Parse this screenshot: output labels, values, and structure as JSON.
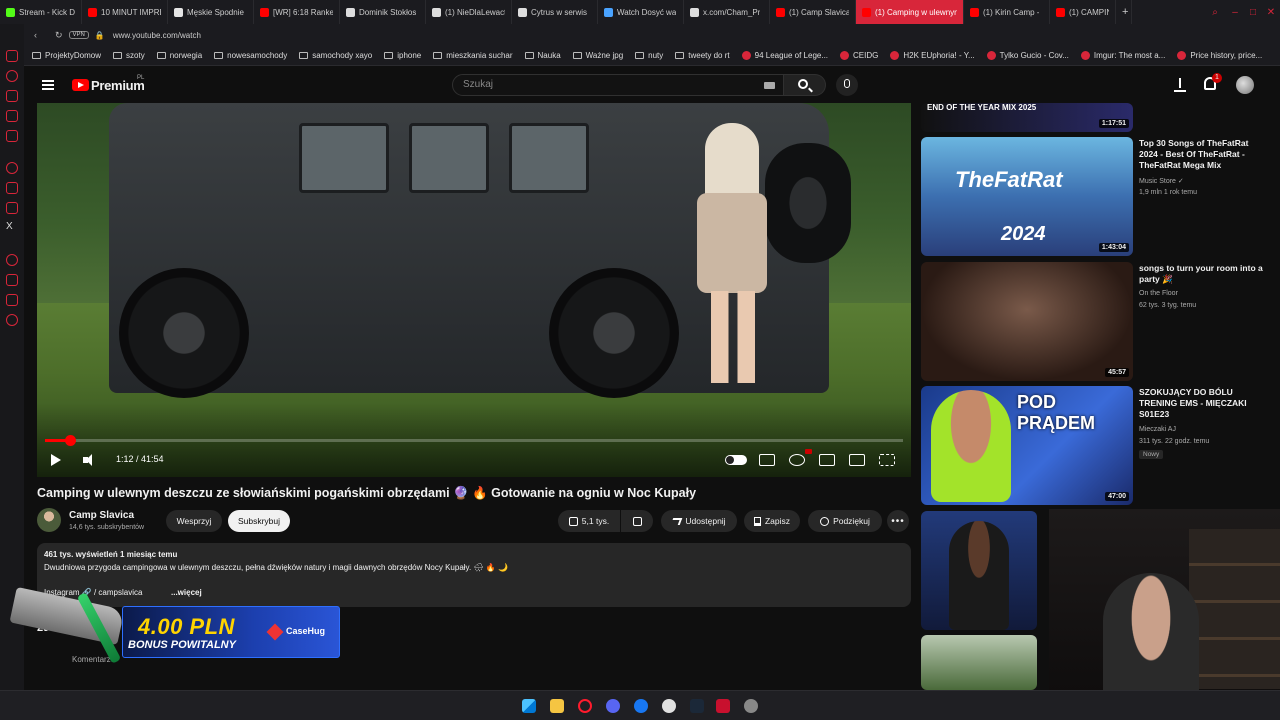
{
  "browser": {
    "tabs": [
      {
        "title": "Stream - Kick Da",
        "favicon_color": "#53fc18"
      },
      {
        "title": "10 MINUT IMPRE",
        "favicon_color": "#ff0000"
      },
      {
        "title": "Męskie Spodnie",
        "favicon_color": "#e5e5e5"
      },
      {
        "title": "[WR] 6:18 Ranke",
        "favicon_color": "#ff0000"
      },
      {
        "title": "Dominik Stokłos",
        "favicon_color": "#dddddd"
      },
      {
        "title": "(1) NieDlaLewact",
        "favicon_color": "#dddddd"
      },
      {
        "title": "Cytrus w serwis",
        "favicon_color": "#dddddd"
      },
      {
        "title": "Watch Dosyć wa",
        "favicon_color": "#4aa3ff"
      },
      {
        "title": "x.com/Cham_Pr",
        "favicon_color": "#dddddd"
      },
      {
        "title": "(1) Camp Slavica",
        "favicon_color": "#ff0000"
      },
      {
        "title": "(1) Camping w ulewnym de",
        "favicon_color": "#ff0000",
        "active": true
      },
      {
        "title": "(1) Kirin Camp -",
        "favicon_color": "#ff0000"
      },
      {
        "title": "(1) CAMPING",
        "favicon_color": "#ff0000"
      }
    ],
    "address": {
      "vpn_label": "VPN",
      "url": "www.youtube.com/watch"
    },
    "bookmarks": [
      {
        "label": "ProjektyDomow",
        "icon": "folder-icon"
      },
      {
        "label": "szoty",
        "icon": "folder-icon"
      },
      {
        "label": "norwegia",
        "icon": "folder-icon"
      },
      {
        "label": "nowesamochody",
        "icon": "folder-icon"
      },
      {
        "label": "samochody xayo",
        "icon": "folder-icon"
      },
      {
        "label": "iphone",
        "icon": "folder-icon"
      },
      {
        "label": "mieszkania suchar",
        "icon": "folder-icon"
      },
      {
        "label": "Nauka",
        "icon": "folder-icon"
      },
      {
        "label": "Ważne jpg",
        "icon": "folder-icon"
      },
      {
        "label": "nuty",
        "icon": "folder-icon"
      },
      {
        "label": "tweety do rt",
        "icon": "folder-icon"
      },
      {
        "label": "94 League of Lege...",
        "icon": "site-icon"
      },
      {
        "label": "CEIDG",
        "icon": "site-icon"
      },
      {
        "label": "H2K EUphoria! - Y...",
        "icon": "site-icon"
      },
      {
        "label": "Tylko Gucio - Cov...",
        "icon": "site-icon"
      },
      {
        "label": "Imgur: The most a...",
        "icon": "site-icon"
      },
      {
        "label": "Price history, price...",
        "icon": "site-icon"
      }
    ]
  },
  "youtube": {
    "header": {
      "logo_text": "Premium",
      "country": "PL",
      "search_placeholder": "Szukaj",
      "notification_count": "1"
    },
    "player": {
      "time": "1:12 / 41:54",
      "progress_fraction": 0.029
    },
    "video": {
      "title": "Camping w ulewnym deszczu ze słowiańskimi pogańskimi obrzędami 🔮 🔥 Gotowanie na ogniu w Noc Kupały",
      "channel_name": "Camp Slavica",
      "subscribers": "14,6 tys. subskrybentów",
      "support_label": "Wesprzyj",
      "subscribe_label": "Subskrybuj",
      "likes": "5,1 tys.",
      "share_label": "Udostępnij",
      "save_label": "Zapisz",
      "thanks_label": "Podziękuj"
    },
    "description": {
      "stats": "461 tys. wyświetleń  1 miesiąc temu",
      "line": "Dwudniowa przygoda campingowa w ulewnym deszczu, pełna dźwięków natury i magii dawnych obrzędów Nocy Kupały. 🌧 🔥 🌙",
      "instagram": "Instagram  🔗 / campslavica",
      "more": "...więcej"
    },
    "comments": {
      "count": "290",
      "label": "Komentarze"
    },
    "recommendations": [
      {
        "overlay": "END OF THE YEAR MIX 2025",
        "duration": "1:17:51"
      },
      {
        "title": "Top 30 Songs of TheFatRat 2024 - Best Of TheFatRat - TheFatRat Mega Mix",
        "channel": "Music Store ✓",
        "meta": "1,9 mln  1 rok temu",
        "duration": "1:43:04",
        "overlay1": "TheFatRat",
        "overlay2": "2024"
      },
      {
        "title": "songs to turn your room into a party 🎉",
        "channel": "On the Floor",
        "meta": "62 tys.  3 tyg. temu",
        "duration": "45:57"
      },
      {
        "title": "SZOKUJĄCY DO BÓLU TRENING EMS - MIĘCZAKI S01E23",
        "channel": "Mieczaki AJ",
        "meta": "311 tys.  22 godz. temu",
        "badge": "Nowy",
        "duration": "47:00",
        "overlay": "POD PRĄDEM"
      }
    ]
  },
  "promo": {
    "amount": "4.00 PLN",
    "subtitle": "BONUS POWITALNY",
    "brand": "CaseHug"
  }
}
